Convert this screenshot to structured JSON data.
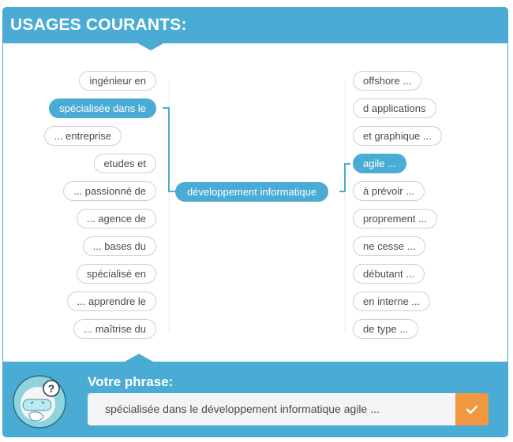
{
  "header": {
    "title": "USAGES COURANTS:"
  },
  "center_node": {
    "label": "développement informatique"
  },
  "left_nodes": [
    {
      "label": "ingénieur en",
      "active": false
    },
    {
      "label": "spécialisée dans le",
      "active": true
    },
    {
      "label": "... entreprise",
      "active": false
    },
    {
      "label": "etudes et",
      "active": false
    },
    {
      "label": "... passionné de",
      "active": false
    },
    {
      "label": "... agence de",
      "active": false
    },
    {
      "label": "... bases du",
      "active": false
    },
    {
      "label": "spécialisé en",
      "active": false
    },
    {
      "label": "... apprendre le",
      "active": false
    },
    {
      "label": "... maîtrise du",
      "active": false
    }
  ],
  "right_nodes": [
    {
      "label": "offshore ...",
      "active": false
    },
    {
      "label": "d applications",
      "active": false
    },
    {
      "label": "et graphique ...",
      "active": false
    },
    {
      "label": "agile ...",
      "active": true
    },
    {
      "label": "à prévoir ...",
      "active": false
    },
    {
      "label": "proprement ...",
      "active": false
    },
    {
      "label": "ne cesse ...",
      "active": false
    },
    {
      "label": "débutant ...",
      "active": false
    },
    {
      "label": "en interne ...",
      "active": false
    },
    {
      "label": "de type ...",
      "active": false
    }
  ],
  "footer": {
    "label": "Votre phrase:",
    "phrase": "spécialisée dans le développement informatique agile ...",
    "validate_icon": "check-icon",
    "mascot_icon": "robot-question-icon"
  },
  "colors": {
    "accent": "#4aacd5",
    "validate": "#f0973f",
    "node_border": "#cfcfcf"
  }
}
